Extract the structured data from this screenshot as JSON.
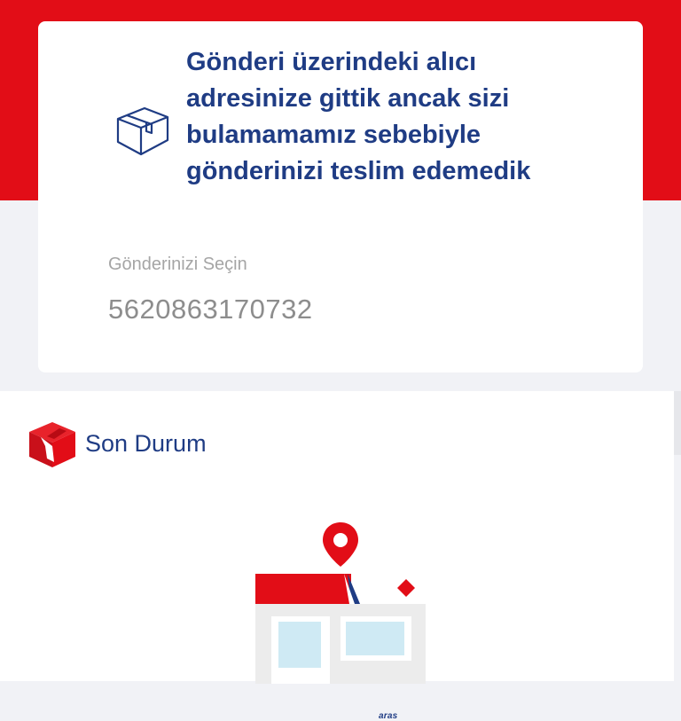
{
  "colors": {
    "brand_red": "#e20d17",
    "brand_navy": "#1f3c84",
    "page_bg": "#f1f2f6"
  },
  "card": {
    "icon": "package-box-icon",
    "message": "Gönderi üzerindeki alıcı adresinize gittik ancak sizi bulamamamız sebebiyle gönderinizi teslim edemedik",
    "select_label": "Gönderinizi Seçin",
    "shipment_number": "5620863170732"
  },
  "status": {
    "icon": "red-package-icon",
    "title": "Son Durum",
    "illustration": "branch-location-icon",
    "brand_text": "aras"
  }
}
